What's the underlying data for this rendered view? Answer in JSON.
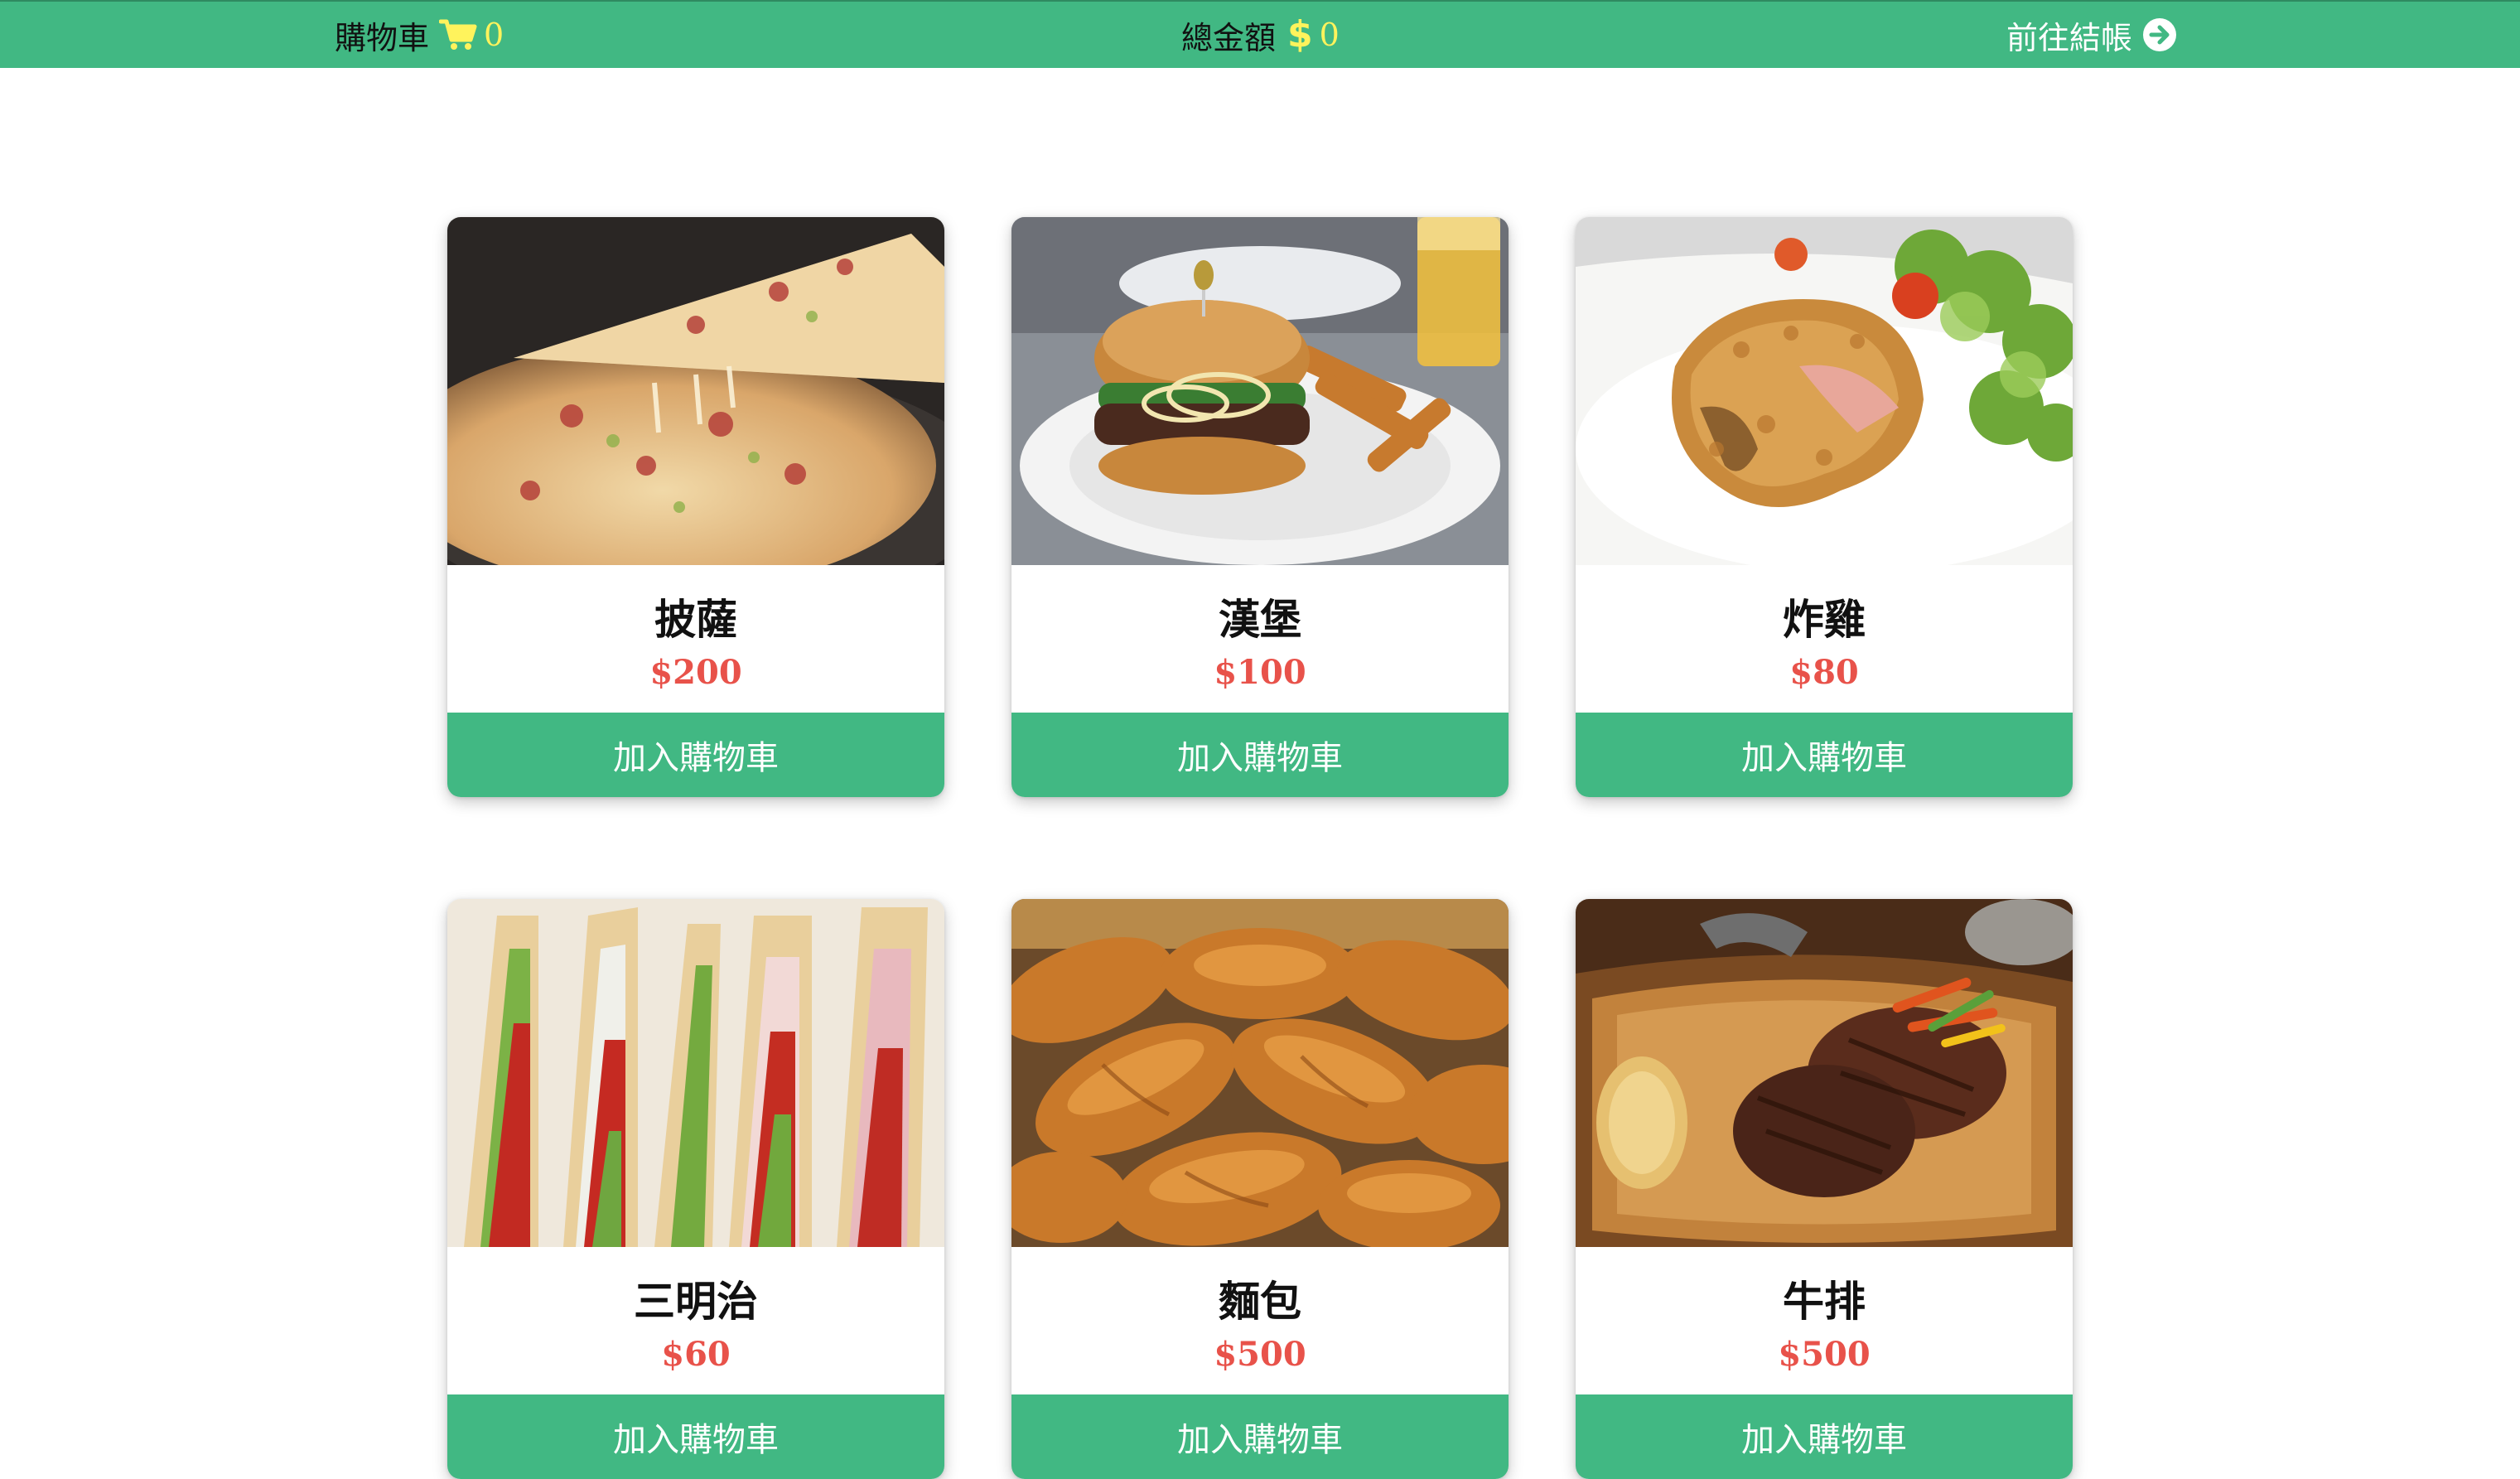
{
  "header": {
    "cart_label": "購物車",
    "cart_count": "0",
    "total_label": "總金額",
    "total_value": "0",
    "checkout_label": "前往結帳",
    "icons": {
      "cart": "shopping-cart-icon",
      "total": "dollar-sign-icon",
      "checkout": "arrow-circle-right-icon"
    },
    "colors": {
      "bar": "#41b883",
      "accent": "#fff35c"
    }
  },
  "products": [
    {
      "name": "披薩",
      "price": "$200",
      "button": "加入購物車"
    },
    {
      "name": "漢堡",
      "price": "$100",
      "button": "加入購物車"
    },
    {
      "name": "炸雞",
      "price": "$80",
      "button": "加入購物車"
    },
    {
      "name": "三明治",
      "price": "$60",
      "button": "加入購物車"
    },
    {
      "name": "麵包",
      "price": "$500",
      "button": "加入購物車"
    },
    {
      "name": "牛排",
      "price": "$500",
      "button": "加入購物車"
    }
  ],
  "colors": {
    "price": "#e8524a",
    "button": "#41b883"
  }
}
